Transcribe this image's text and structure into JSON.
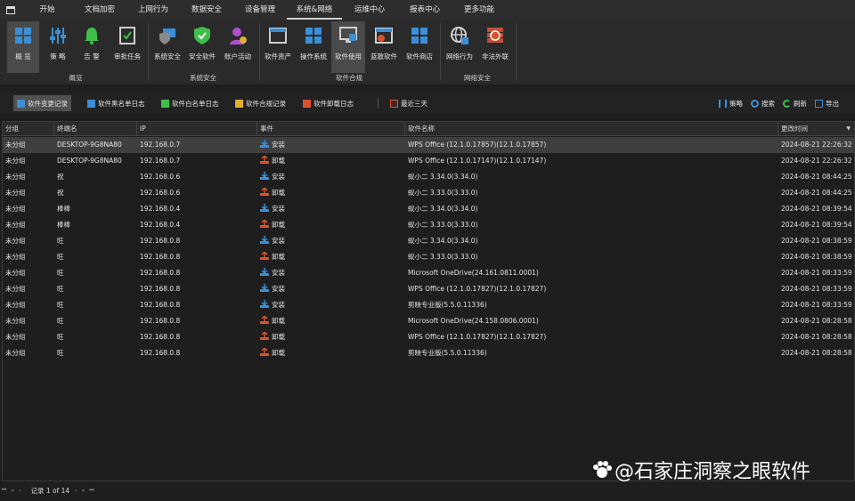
{
  "menu": {
    "tabs": [
      "开始",
      "文档加密",
      "上网行为",
      "数据安全",
      "设备管理",
      "系统&网络",
      "运维中心",
      "报表中心",
      "更多功能"
    ],
    "active": "系统&网络"
  },
  "ribbon": {
    "buttons": [
      "概 览",
      "策 略",
      "告 警",
      "审批任务",
      "系统安全",
      "安全软件",
      "账户活动",
      "软件资产",
      "操作系统",
      "软件使用",
      "蓝散软件",
      "软件商店",
      "网络行为",
      "非法外联"
    ],
    "groups": [
      "概览",
      "系统安全",
      "软件合规",
      "网络安全"
    ]
  },
  "toolbar": {
    "left": [
      "软件变更记录",
      "软件黑名单日志",
      "软件白名单日志",
      "软件合规记录",
      "软件卸载日志",
      "最近三天"
    ],
    "right": [
      "策略",
      "搜索",
      "刷新",
      "导出"
    ]
  },
  "table": {
    "columns": [
      "分组",
      "终端名",
      "IP",
      "事件",
      "软件名称",
      "更改时间"
    ],
    "rows": [
      [
        "未分组",
        "DESKTOP-9G8NA80",
        "192.168.0.7",
        "安装",
        "WPS Office (12.1.0.17857)(12.1.0.17857)",
        "2024-08-21 22:26:32"
      ],
      [
        "未分组",
        "DESKTOP-9G8NA80",
        "192.168.0.7",
        "卸载",
        "WPS Office (12.1.0.17147)(12.1.0.17147)",
        "2024-08-21 22:26:32"
      ],
      [
        "未分组",
        "祝",
        "192.168.0.6",
        "安装",
        "蚁小二 3.34.0(3.34.0)",
        "2024-08-21 08:44:25"
      ],
      [
        "未分组",
        "祝",
        "192.168.0.6",
        "卸载",
        "蚁小二 3.33.0(3.33.0)",
        "2024-08-21 08:44:25"
      ],
      [
        "未分组",
        "棒棒",
        "192.168.0.4",
        "安装",
        "蚁小二 3.34.0(3.34.0)",
        "2024-08-21 08:39:54"
      ],
      [
        "未分组",
        "棒棒",
        "192.168.0.4",
        "卸载",
        "蚁小二 3.33.0(3.33.0)",
        "2024-08-21 08:39:54"
      ],
      [
        "未分组",
        "旺",
        "192.168.0.8",
        "安装",
        "蚁小二 3.34.0(3.34.0)",
        "2024-08-21 08:38:59"
      ],
      [
        "未分组",
        "旺",
        "192.168.0.8",
        "卸载",
        "蚁小二 3.33.0(3.33.0)",
        "2024-08-21 08:38:59"
      ],
      [
        "未分组",
        "旺",
        "192.168.0.8",
        "安装",
        "Microsoft OneDrive(24.161.0811.0001)",
        "2024-08-21 08:33:59"
      ],
      [
        "未分组",
        "旺",
        "192.168.0.8",
        "安装",
        "WPS Office (12.1.0.17827)(12.1.0.17827)",
        "2024-08-21 08:33:59"
      ],
      [
        "未分组",
        "旺",
        "192.168.0.8",
        "安装",
        "剪映专业版(5.5.0.11336)",
        "2024-08-21 08:33:59"
      ],
      [
        "未分组",
        "旺",
        "192.168.0.8",
        "卸载",
        "Microsoft OneDrive(24.158.0806.0001)",
        "2024-08-21 08:28:58"
      ],
      [
        "未分组",
        "旺",
        "192.168.0.8",
        "卸载",
        "WPS Office (12.1.0.17827)(12.1.0.17827)",
        "2024-08-21 08:28:58"
      ],
      [
        "未分组",
        "旺",
        "192.168.0.8",
        "卸载",
        "剪映专业版(5.5.0.11336)",
        "2024-08-21 08:28:58"
      ]
    ]
  },
  "pager": {
    "record_text": "记录 1 of 14"
  },
  "watermark": "@石家庄洞察之眼软件",
  "colors": {
    "install": "#3b8fd6",
    "uninstall": "#d9532c",
    "accent": "#2f8be0"
  }
}
